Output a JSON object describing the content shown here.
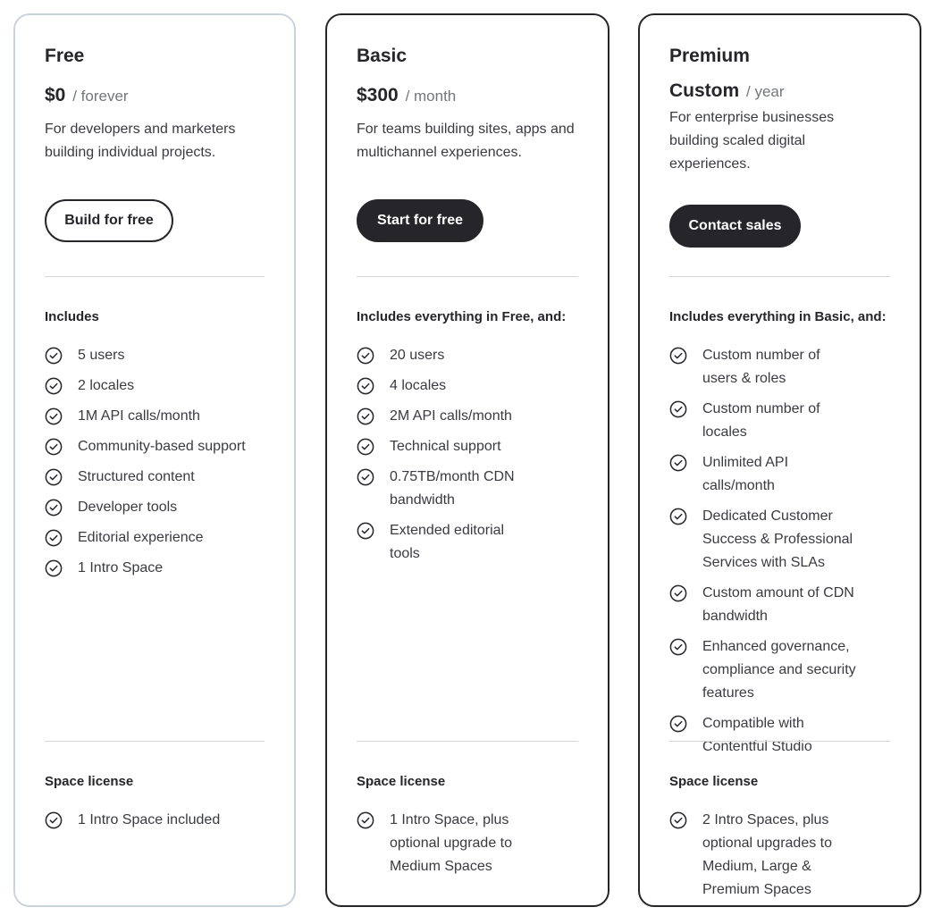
{
  "plans": [
    {
      "name": "Free",
      "price": "$0",
      "period": "/ forever",
      "description": "For developers and marketers building individual projects.",
      "cta": "Build for free",
      "includes_title": "Includes",
      "features": [
        "5 users",
        "2 locales",
        "1M API calls/month",
        "Community-based support",
        "Structured content",
        "Developer tools",
        "Editorial experience",
        "1 Intro Space"
      ],
      "license_title": "Space license",
      "license": [
        "1 Intro Space included"
      ]
    },
    {
      "name": "Basic",
      "price": "$300",
      "period": "/ month",
      "description": "For teams building sites, apps and multichannel experiences.",
      "cta": "Start for free",
      "includes_title": "Includes everything in Free, and:",
      "features": [
        "20 users",
        "4 locales",
        "2M API calls/month",
        "Technical support",
        "0.75TB/month CDN bandwidth",
        "Extended editorial tools"
      ],
      "license_title": "Space license",
      "license": [
        "1 Intro Space, plus optional upgrade to Medium Spaces"
      ]
    },
    {
      "name": "Premium",
      "price": "Custom",
      "period": "/ year",
      "description": "For enterprise businesses building scaled digital experiences.",
      "cta": "Contact sales",
      "includes_title": "Includes everything in Basic, and:",
      "features": [
        "Custom number of users & roles",
        "Custom number of locales",
        "Unlimited API calls/month",
        "Dedicated Customer Success & Professional Services with SLAs",
        "Custom amount of CDN bandwidth",
        "Enhanced governance, compliance and security features",
        "Compatible with Contentful Studio"
      ],
      "license_title": "Space license",
      "license": [
        "2 Intro Spaces, plus optional upgrades to Medium, Large & Premium Spaces"
      ]
    }
  ],
  "icons": {
    "feature": "check-circle-icon"
  },
  "colors": {
    "primary": "#25252a",
    "free_border": "#c9d3dc",
    "divider": "#d3d7dc",
    "muted": "#73767c"
  }
}
